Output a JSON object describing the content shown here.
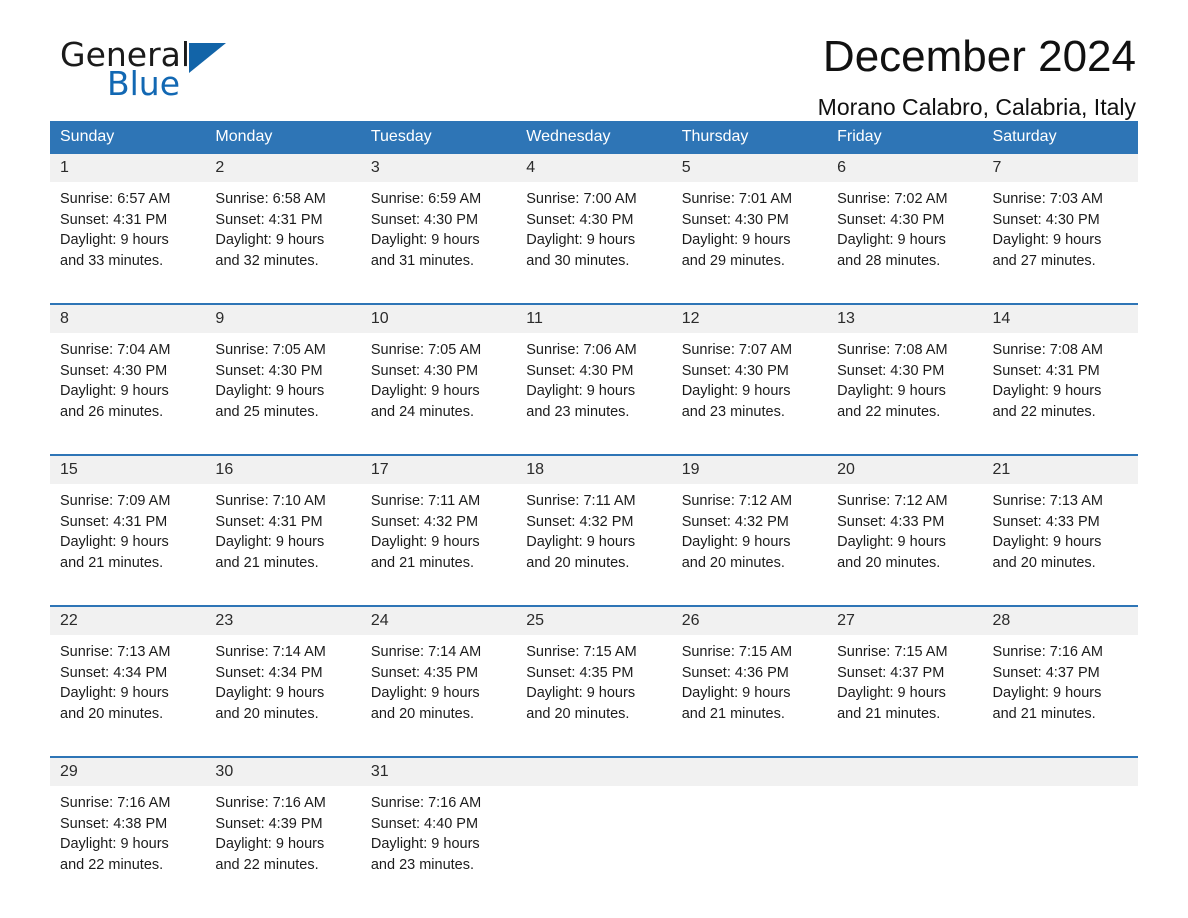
{
  "brand": {
    "name_part1": "General",
    "name_part2": "Blue",
    "flag_icon": "triangle-flag-icon",
    "accent_color": "#1268b3"
  },
  "header": {
    "title": "December 2024",
    "subtitle": "Morano Calabro, Calabria, Italy"
  },
  "colors": {
    "header_blue": "#2e75b6",
    "daynum_gray": "#f1f1f1",
    "text": "#1c1c1c"
  },
  "weekday_headers": [
    "Sunday",
    "Monday",
    "Tuesday",
    "Wednesday",
    "Thursday",
    "Friday",
    "Saturday"
  ],
  "weeks": [
    {
      "days": [
        {
          "num": "1",
          "sunrise": "Sunrise: 6:57 AM",
          "sunset": "Sunset: 4:31 PM",
          "daylight1": "Daylight: 9 hours",
          "daylight2": "and 33 minutes."
        },
        {
          "num": "2",
          "sunrise": "Sunrise: 6:58 AM",
          "sunset": "Sunset: 4:31 PM",
          "daylight1": "Daylight: 9 hours",
          "daylight2": "and 32 minutes."
        },
        {
          "num": "3",
          "sunrise": "Sunrise: 6:59 AM",
          "sunset": "Sunset: 4:30 PM",
          "daylight1": "Daylight: 9 hours",
          "daylight2": "and 31 minutes."
        },
        {
          "num": "4",
          "sunrise": "Sunrise: 7:00 AM",
          "sunset": "Sunset: 4:30 PM",
          "daylight1": "Daylight: 9 hours",
          "daylight2": "and 30 minutes."
        },
        {
          "num": "5",
          "sunrise": "Sunrise: 7:01 AM",
          "sunset": "Sunset: 4:30 PM",
          "daylight1": "Daylight: 9 hours",
          "daylight2": "and 29 minutes."
        },
        {
          "num": "6",
          "sunrise": "Sunrise: 7:02 AM",
          "sunset": "Sunset: 4:30 PM",
          "daylight1": "Daylight: 9 hours",
          "daylight2": "and 28 minutes."
        },
        {
          "num": "7",
          "sunrise": "Sunrise: 7:03 AM",
          "sunset": "Sunset: 4:30 PM",
          "daylight1": "Daylight: 9 hours",
          "daylight2": "and 27 minutes."
        }
      ]
    },
    {
      "days": [
        {
          "num": "8",
          "sunrise": "Sunrise: 7:04 AM",
          "sunset": "Sunset: 4:30 PM",
          "daylight1": "Daylight: 9 hours",
          "daylight2": "and 26 minutes."
        },
        {
          "num": "9",
          "sunrise": "Sunrise: 7:05 AM",
          "sunset": "Sunset: 4:30 PM",
          "daylight1": "Daylight: 9 hours",
          "daylight2": "and 25 minutes."
        },
        {
          "num": "10",
          "sunrise": "Sunrise: 7:05 AM",
          "sunset": "Sunset: 4:30 PM",
          "daylight1": "Daylight: 9 hours",
          "daylight2": "and 24 minutes."
        },
        {
          "num": "11",
          "sunrise": "Sunrise: 7:06 AM",
          "sunset": "Sunset: 4:30 PM",
          "daylight1": "Daylight: 9 hours",
          "daylight2": "and 23 minutes."
        },
        {
          "num": "12",
          "sunrise": "Sunrise: 7:07 AM",
          "sunset": "Sunset: 4:30 PM",
          "daylight1": "Daylight: 9 hours",
          "daylight2": "and 23 minutes."
        },
        {
          "num": "13",
          "sunrise": "Sunrise: 7:08 AM",
          "sunset": "Sunset: 4:30 PM",
          "daylight1": "Daylight: 9 hours",
          "daylight2": "and 22 minutes."
        },
        {
          "num": "14",
          "sunrise": "Sunrise: 7:08 AM",
          "sunset": "Sunset: 4:31 PM",
          "daylight1": "Daylight: 9 hours",
          "daylight2": "and 22 minutes."
        }
      ]
    },
    {
      "days": [
        {
          "num": "15",
          "sunrise": "Sunrise: 7:09 AM",
          "sunset": "Sunset: 4:31 PM",
          "daylight1": "Daylight: 9 hours",
          "daylight2": "and 21 minutes."
        },
        {
          "num": "16",
          "sunrise": "Sunrise: 7:10 AM",
          "sunset": "Sunset: 4:31 PM",
          "daylight1": "Daylight: 9 hours",
          "daylight2": "and 21 minutes."
        },
        {
          "num": "17",
          "sunrise": "Sunrise: 7:11 AM",
          "sunset": "Sunset: 4:32 PM",
          "daylight1": "Daylight: 9 hours",
          "daylight2": "and 21 minutes."
        },
        {
          "num": "18",
          "sunrise": "Sunrise: 7:11 AM",
          "sunset": "Sunset: 4:32 PM",
          "daylight1": "Daylight: 9 hours",
          "daylight2": "and 20 minutes."
        },
        {
          "num": "19",
          "sunrise": "Sunrise: 7:12 AM",
          "sunset": "Sunset: 4:32 PM",
          "daylight1": "Daylight: 9 hours",
          "daylight2": "and 20 minutes."
        },
        {
          "num": "20",
          "sunrise": "Sunrise: 7:12 AM",
          "sunset": "Sunset: 4:33 PM",
          "daylight1": "Daylight: 9 hours",
          "daylight2": "and 20 minutes."
        },
        {
          "num": "21",
          "sunrise": "Sunrise: 7:13 AM",
          "sunset": "Sunset: 4:33 PM",
          "daylight1": "Daylight: 9 hours",
          "daylight2": "and 20 minutes."
        }
      ]
    },
    {
      "days": [
        {
          "num": "22",
          "sunrise": "Sunrise: 7:13 AM",
          "sunset": "Sunset: 4:34 PM",
          "daylight1": "Daylight: 9 hours",
          "daylight2": "and 20 minutes."
        },
        {
          "num": "23",
          "sunrise": "Sunrise: 7:14 AM",
          "sunset": "Sunset: 4:34 PM",
          "daylight1": "Daylight: 9 hours",
          "daylight2": "and 20 minutes."
        },
        {
          "num": "24",
          "sunrise": "Sunrise: 7:14 AM",
          "sunset": "Sunset: 4:35 PM",
          "daylight1": "Daylight: 9 hours",
          "daylight2": "and 20 minutes."
        },
        {
          "num": "25",
          "sunrise": "Sunrise: 7:15 AM",
          "sunset": "Sunset: 4:35 PM",
          "daylight1": "Daylight: 9 hours",
          "daylight2": "and 20 minutes."
        },
        {
          "num": "26",
          "sunrise": "Sunrise: 7:15 AM",
          "sunset": "Sunset: 4:36 PM",
          "daylight1": "Daylight: 9 hours",
          "daylight2": "and 21 minutes."
        },
        {
          "num": "27",
          "sunrise": "Sunrise: 7:15 AM",
          "sunset": "Sunset: 4:37 PM",
          "daylight1": "Daylight: 9 hours",
          "daylight2": "and 21 minutes."
        },
        {
          "num": "28",
          "sunrise": "Sunrise: 7:16 AM",
          "sunset": "Sunset: 4:37 PM",
          "daylight1": "Daylight: 9 hours",
          "daylight2": "and 21 minutes."
        }
      ]
    },
    {
      "days": [
        {
          "num": "29",
          "sunrise": "Sunrise: 7:16 AM",
          "sunset": "Sunset: 4:38 PM",
          "daylight1": "Daylight: 9 hours",
          "daylight2": "and 22 minutes."
        },
        {
          "num": "30",
          "sunrise": "Sunrise: 7:16 AM",
          "sunset": "Sunset: 4:39 PM",
          "daylight1": "Daylight: 9 hours",
          "daylight2": "and 22 minutes."
        },
        {
          "num": "31",
          "sunrise": "Sunrise: 7:16 AM",
          "sunset": "Sunset: 4:40 PM",
          "daylight1": "Daylight: 9 hours",
          "daylight2": "and 23 minutes."
        },
        {
          "num": "",
          "sunrise": "",
          "sunset": "",
          "daylight1": "",
          "daylight2": ""
        },
        {
          "num": "",
          "sunrise": "",
          "sunset": "",
          "daylight1": "",
          "daylight2": ""
        },
        {
          "num": "",
          "sunrise": "",
          "sunset": "",
          "daylight1": "",
          "daylight2": ""
        },
        {
          "num": "",
          "sunrise": "",
          "sunset": "",
          "daylight1": "",
          "daylight2": ""
        }
      ]
    }
  ]
}
